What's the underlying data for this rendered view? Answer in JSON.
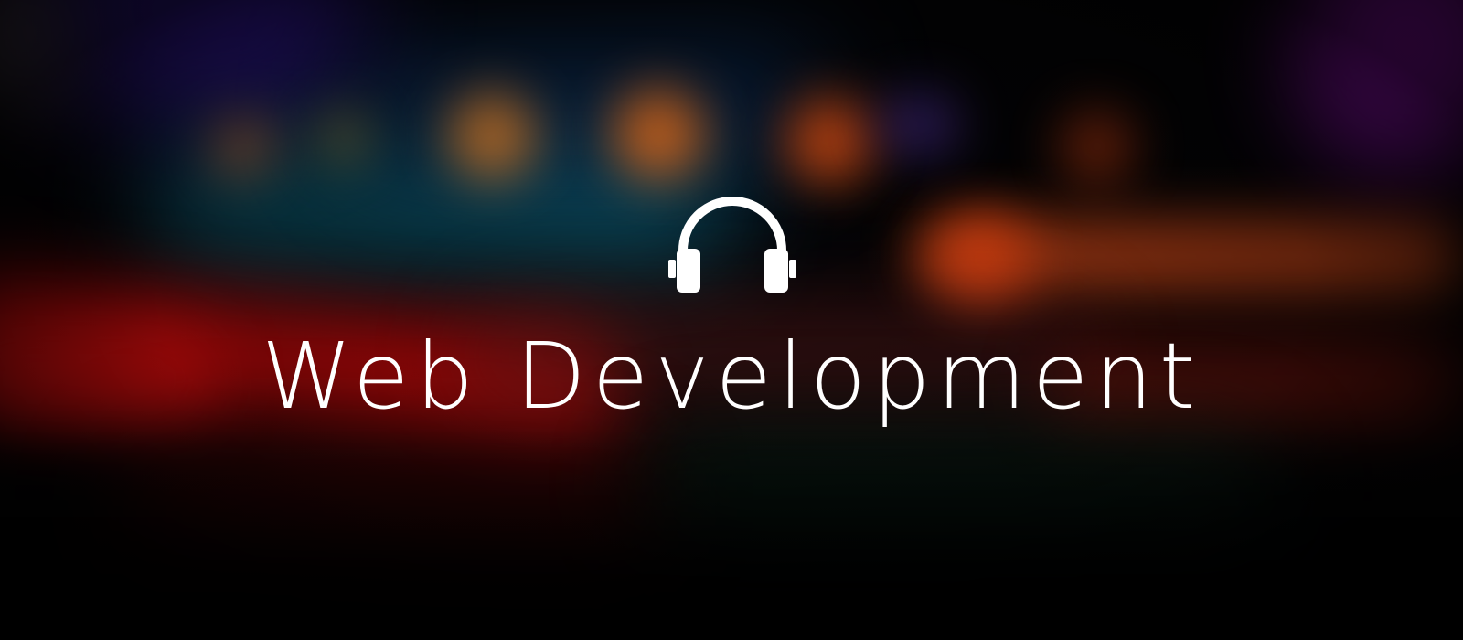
{
  "banner": {
    "title": "Web Development",
    "icon": "headphones-icon",
    "text_color": "#ffffff"
  }
}
